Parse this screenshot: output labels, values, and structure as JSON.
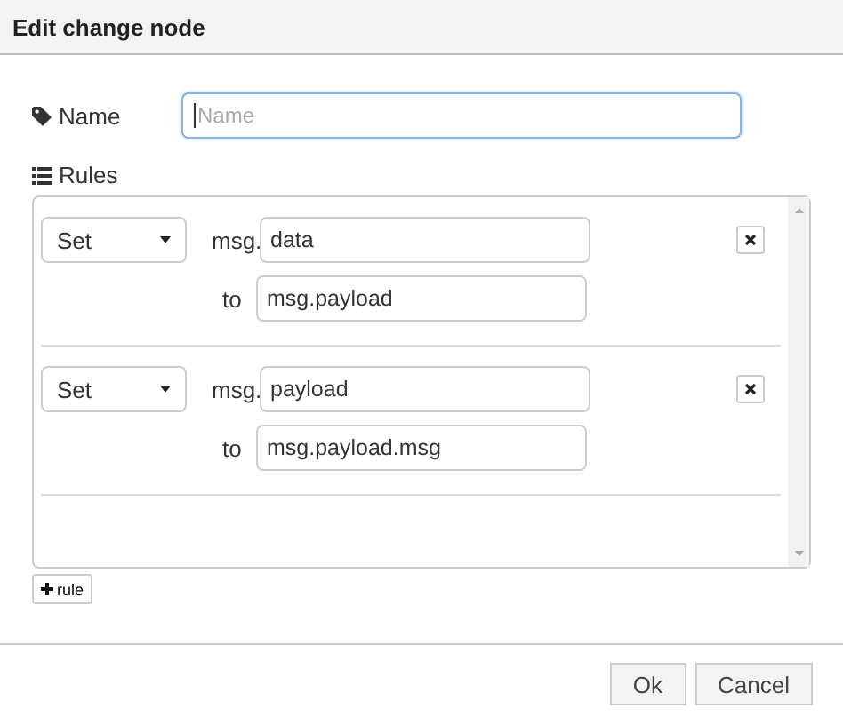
{
  "dialog": {
    "title": "Edit change node"
  },
  "name_field": {
    "label": "Name",
    "placeholder": "Name",
    "focused": true
  },
  "rules_label": "Rules",
  "rules": [
    {
      "action": "Set",
      "prefix": "msg.",
      "property": "data",
      "to_label": "to",
      "to_value": "msg.payload"
    },
    {
      "action": "Set",
      "prefix": "msg.",
      "property": "payload",
      "to_label": "to",
      "to_value": "msg.payload.msg"
    }
  ],
  "add_rule_button": "rule",
  "buttons": [
    "Ok",
    "Cancel"
  ]
}
